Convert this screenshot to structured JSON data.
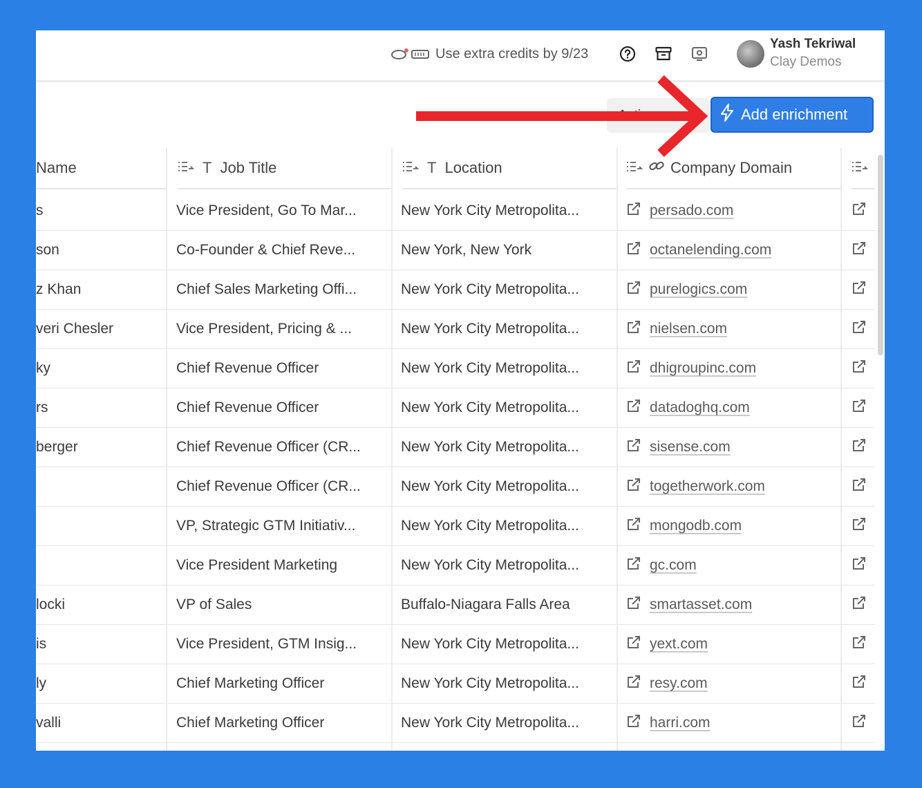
{
  "topbar": {
    "credits_text": "Use extra credits by 9/23",
    "icons": [
      "help-icon",
      "archive-icon",
      "screen-record-icon"
    ],
    "user": {
      "name": "Yash Tekriwal",
      "workspace": "Clay Demos"
    }
  },
  "toolbar": {
    "actions_label": "Actions",
    "enrich_label": "Add enrichment",
    "accent_color": "#2F7EE6"
  },
  "annotation": {
    "arrow_color": "#E8262B"
  },
  "table": {
    "headers": {
      "name": "Name",
      "job_title": "Job Title",
      "location": "Location",
      "company_domain": "Company Domain"
    },
    "rows": [
      {
        "name": "s",
        "title": "Vice President, Go To Mar...",
        "location": "New York City Metropolita...",
        "domain": "persado.com"
      },
      {
        "name": "son",
        "title": "Co-Founder & Chief Reve...",
        "location": "New York, New York",
        "domain": "octanelending.com"
      },
      {
        "name": "z Khan",
        "title": "Chief Sales Marketing Offi...",
        "location": "New York City Metropolita...",
        "domain": "purelogics.com"
      },
      {
        "name": "veri Chesler",
        "title": "Vice President, Pricing & ...",
        "location": "New York City Metropolita...",
        "domain": "nielsen.com"
      },
      {
        "name": "ky",
        "title": "Chief Revenue Officer",
        "location": "New York City Metropolita...",
        "domain": "dhigroupinc.com"
      },
      {
        "name": "rs",
        "title": "Chief Revenue Officer",
        "location": "New York City Metropolita...",
        "domain": "datadoghq.com"
      },
      {
        "name": "berger",
        "title": "Chief Revenue Officer (CR...",
        "location": "New York City Metropolita...",
        "domain": "sisense.com"
      },
      {
        "name": "",
        "title": "Chief Revenue Officer (CR...",
        "location": "New York City Metropolita...",
        "domain": "togetherwork.com"
      },
      {
        "name": "",
        "title": "VP, Strategic GTM Initiativ...",
        "location": "New York City Metropolita...",
        "domain": "mongodb.com"
      },
      {
        "name": "",
        "title": "Vice President Marketing",
        "location": "New York City Metropolita...",
        "domain": "gc.com"
      },
      {
        "name": "locki",
        "title": "VP of Sales",
        "location": "Buffalo-Niagara Falls Area",
        "domain": "smartasset.com"
      },
      {
        "name": "is",
        "title": "Vice President, GTM Insig...",
        "location": "New York City Metropolita...",
        "domain": "yext.com"
      },
      {
        "name": "ly",
        "title": "Chief Marketing Officer",
        "location": "New York City Metropolita...",
        "domain": "resy.com"
      },
      {
        "name": "valli",
        "title": "Chief Marketing Officer",
        "location": "New York City Metropolita...",
        "domain": "harri.com"
      }
    ]
  }
}
